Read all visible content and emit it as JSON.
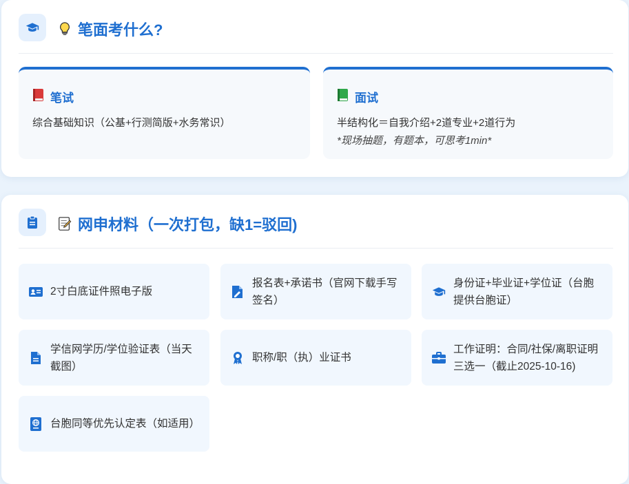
{
  "exam_section": {
    "title": "笔面考什么?",
    "written": {
      "label": "笔试",
      "desc": "综合基础知识（公基+行测简版+水务常识）"
    },
    "interview": {
      "label": "面试",
      "desc": "半结构化＝自我介绍+2道专业+2道行为",
      "note": "*现场抽题，有题本，可思考1min*"
    }
  },
  "materials_section": {
    "title": "网申材料（一次打包，缺1=驳回)",
    "items": [
      {
        "icon": "id-card-icon",
        "text": "2寸白底证件照电子版"
      },
      {
        "icon": "signature-icon",
        "text": "报名表+承诺书（官网下载手写签名）"
      },
      {
        "icon": "graduation-cap-icon",
        "text": "身份证+毕业证+学位证（台胞提供台胞证）"
      },
      {
        "icon": "document-icon",
        "text": "学信网学历/学位验证表（当天截图）"
      },
      {
        "icon": "award-icon",
        "text": "职称/职（执）业证书"
      },
      {
        "icon": "briefcase-icon",
        "text": "工作证明：合同/社保/离职证明三选一（截止2025-10-16)"
      },
      {
        "icon": "passport-icon",
        "text": "台胞同等优先认定表（如适用）"
      }
    ]
  },
  "colors": {
    "accent": "#1f6fd0",
    "tile_bg": "#f1f7fe",
    "page_bg": "#eaf3fc"
  }
}
